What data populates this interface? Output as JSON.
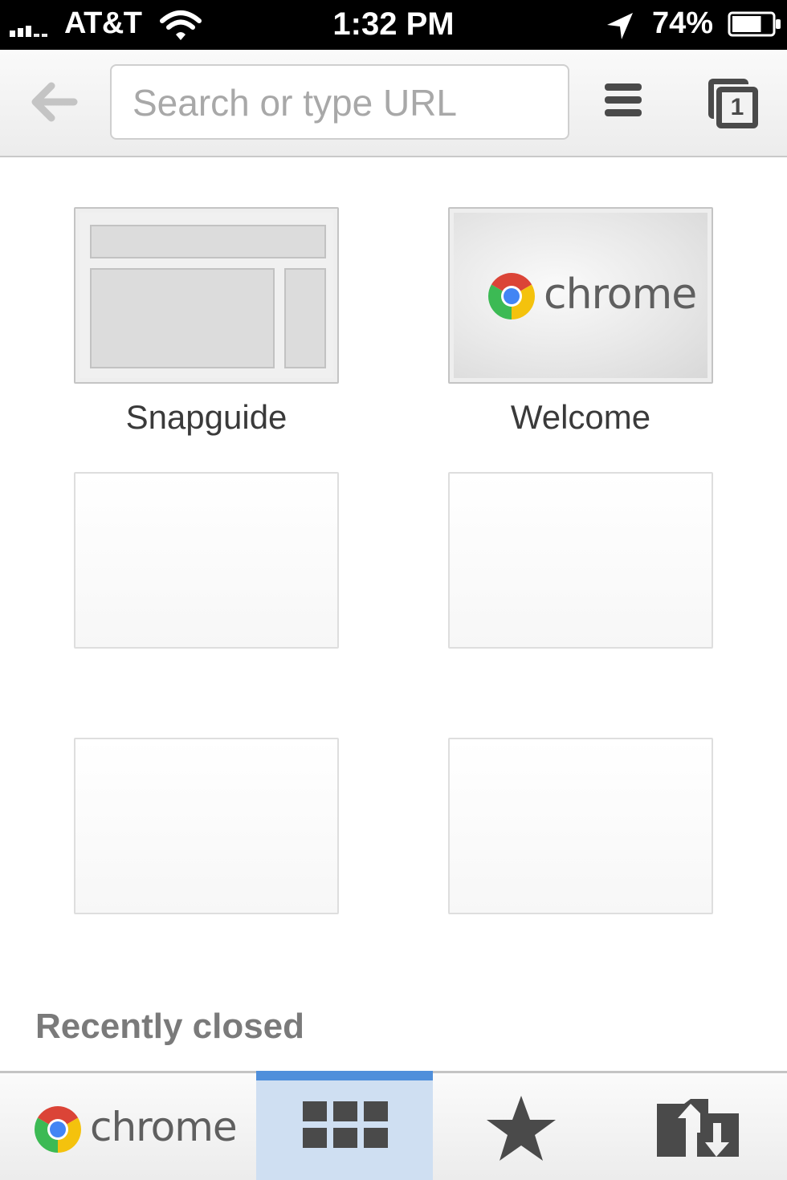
{
  "status_bar": {
    "carrier": "AT&T",
    "time": "1:32 PM",
    "battery": "74%",
    "battery_level": 0.74,
    "icons": [
      "signal-icon",
      "wifi-icon",
      "location-arrow-icon",
      "battery-icon"
    ]
  },
  "toolbar": {
    "back_icon": "back-arrow-icon",
    "search_placeholder": "Search or type URL",
    "search_value": "",
    "menu_icon": "menu-icon",
    "tab_count": "1"
  },
  "most_visited": [
    {
      "label": "Snapguide",
      "thumbnail": "page-layout-placeholder"
    },
    {
      "label": "Welcome",
      "thumbnail": "chrome-logo"
    },
    {
      "label": "",
      "thumbnail": "empty"
    },
    {
      "label": "",
      "thumbnail": "empty"
    },
    {
      "label": "",
      "thumbnail": "empty"
    },
    {
      "label": "",
      "thumbnail": "empty"
    }
  ],
  "welcome_thumb_text": "chrome",
  "recently_closed": "Recently closed",
  "bottom_bar": {
    "logo_text": "chrome",
    "tabs": [
      {
        "icon": "grid-icon",
        "selected": true
      },
      {
        "icon": "star-icon",
        "selected": false
      },
      {
        "icon": "sync-devices-icon",
        "selected": false
      }
    ]
  },
  "colors": {
    "selected_tab_bg": "#cfdff2",
    "selected_tab_accent": "#4f8fdb",
    "chrome_red": "#db4437",
    "chrome_yellow": "#f4c20d",
    "chrome_green": "#3cba54",
    "chrome_blue": "#4285f4"
  }
}
